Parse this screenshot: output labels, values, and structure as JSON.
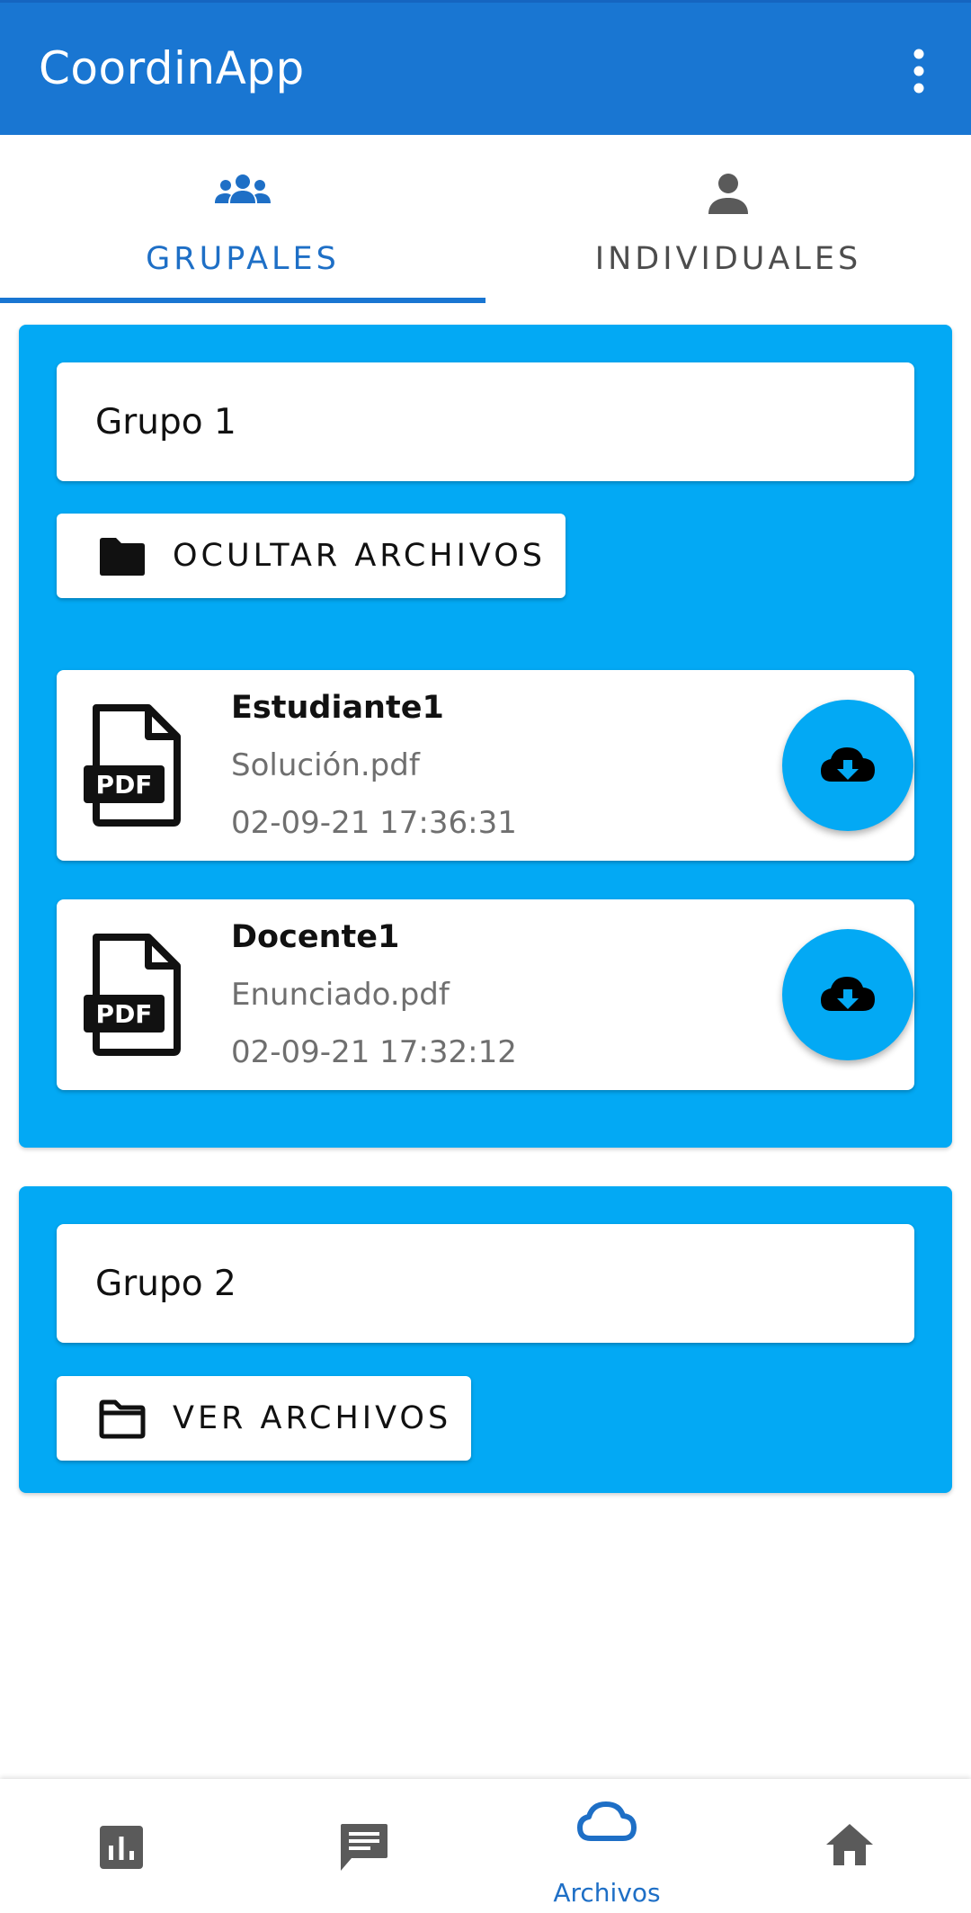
{
  "app": {
    "title": "CoordinApp"
  },
  "tabs": [
    {
      "label": "GRUPALES",
      "icon": "group-icon",
      "active": true
    },
    {
      "label": "INDIVIDUALES",
      "icon": "person-icon",
      "active": false
    }
  ],
  "groups": [
    {
      "name": "Grupo 1",
      "toggle_label": "OCULTAR ARCHIVOS",
      "toggle_icon": "folder-filled-icon",
      "files": [
        {
          "author": "Estudiante1",
          "filename": "Solución.pdf",
          "date": "02-09-21 17:36:31"
        },
        {
          "author": "Docente1",
          "filename": "Enunciado.pdf",
          "date": "02-09-21 17:32:12"
        }
      ]
    },
    {
      "name": "Grupo 2",
      "toggle_label": "VER ARCHIVOS",
      "toggle_icon": "folder-outline-icon",
      "files": []
    }
  ],
  "bottom_nav": [
    {
      "icon": "bar-chart-icon",
      "label": ""
    },
    {
      "icon": "chat-icon",
      "label": ""
    },
    {
      "icon": "cloud-icon",
      "label": "Archivos",
      "active": true
    },
    {
      "icon": "home-icon",
      "label": ""
    }
  ],
  "colors": {
    "primary": "#1976D2",
    "accent": "#03A9F4",
    "active_text": "#1E6FC6"
  }
}
